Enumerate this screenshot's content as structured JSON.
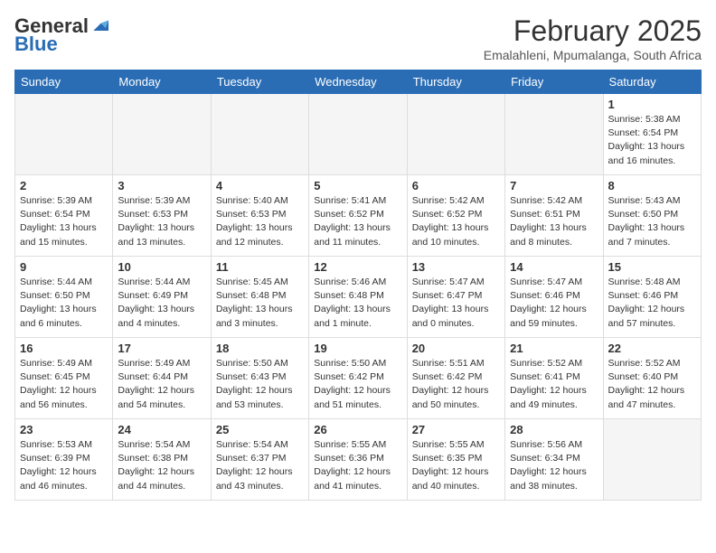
{
  "header": {
    "logo_general": "General",
    "logo_blue": "Blue",
    "month_title": "February 2025",
    "subtitle": "Emalahleni, Mpumalanga, South Africa"
  },
  "weekdays": [
    "Sunday",
    "Monday",
    "Tuesday",
    "Wednesday",
    "Thursday",
    "Friday",
    "Saturday"
  ],
  "weeks": [
    [
      {
        "day": "",
        "empty": true
      },
      {
        "day": "",
        "empty": true
      },
      {
        "day": "",
        "empty": true
      },
      {
        "day": "",
        "empty": true
      },
      {
        "day": "",
        "empty": true
      },
      {
        "day": "",
        "empty": true
      },
      {
        "day": "1",
        "sunrise": "5:38 AM",
        "sunset": "6:54 PM",
        "daylight": "13 hours and 16 minutes."
      }
    ],
    [
      {
        "day": "2",
        "sunrise": "5:39 AM",
        "sunset": "6:54 PM",
        "daylight": "13 hours and 15 minutes."
      },
      {
        "day": "3",
        "sunrise": "5:39 AM",
        "sunset": "6:53 PM",
        "daylight": "13 hours and 13 minutes."
      },
      {
        "day": "4",
        "sunrise": "5:40 AM",
        "sunset": "6:53 PM",
        "daylight": "13 hours and 12 minutes."
      },
      {
        "day": "5",
        "sunrise": "5:41 AM",
        "sunset": "6:52 PM",
        "daylight": "13 hours and 11 minutes."
      },
      {
        "day": "6",
        "sunrise": "5:42 AM",
        "sunset": "6:52 PM",
        "daylight": "13 hours and 10 minutes."
      },
      {
        "day": "7",
        "sunrise": "5:42 AM",
        "sunset": "6:51 PM",
        "daylight": "13 hours and 8 minutes."
      },
      {
        "day": "8",
        "sunrise": "5:43 AM",
        "sunset": "6:50 PM",
        "daylight": "13 hours and 7 minutes."
      }
    ],
    [
      {
        "day": "9",
        "sunrise": "5:44 AM",
        "sunset": "6:50 PM",
        "daylight": "13 hours and 6 minutes."
      },
      {
        "day": "10",
        "sunrise": "5:44 AM",
        "sunset": "6:49 PM",
        "daylight": "13 hours and 4 minutes."
      },
      {
        "day": "11",
        "sunrise": "5:45 AM",
        "sunset": "6:48 PM",
        "daylight": "13 hours and 3 minutes."
      },
      {
        "day": "12",
        "sunrise": "5:46 AM",
        "sunset": "6:48 PM",
        "daylight": "13 hours and 1 minute."
      },
      {
        "day": "13",
        "sunrise": "5:47 AM",
        "sunset": "6:47 PM",
        "daylight": "13 hours and 0 minutes."
      },
      {
        "day": "14",
        "sunrise": "5:47 AM",
        "sunset": "6:46 PM",
        "daylight": "12 hours and 59 minutes."
      },
      {
        "day": "15",
        "sunrise": "5:48 AM",
        "sunset": "6:46 PM",
        "daylight": "12 hours and 57 minutes."
      }
    ],
    [
      {
        "day": "16",
        "sunrise": "5:49 AM",
        "sunset": "6:45 PM",
        "daylight": "12 hours and 56 minutes."
      },
      {
        "day": "17",
        "sunrise": "5:49 AM",
        "sunset": "6:44 PM",
        "daylight": "12 hours and 54 minutes."
      },
      {
        "day": "18",
        "sunrise": "5:50 AM",
        "sunset": "6:43 PM",
        "daylight": "12 hours and 53 minutes."
      },
      {
        "day": "19",
        "sunrise": "5:50 AM",
        "sunset": "6:42 PM",
        "daylight": "12 hours and 51 minutes."
      },
      {
        "day": "20",
        "sunrise": "5:51 AM",
        "sunset": "6:42 PM",
        "daylight": "12 hours and 50 minutes."
      },
      {
        "day": "21",
        "sunrise": "5:52 AM",
        "sunset": "6:41 PM",
        "daylight": "12 hours and 49 minutes."
      },
      {
        "day": "22",
        "sunrise": "5:52 AM",
        "sunset": "6:40 PM",
        "daylight": "12 hours and 47 minutes."
      }
    ],
    [
      {
        "day": "23",
        "sunrise": "5:53 AM",
        "sunset": "6:39 PM",
        "daylight": "12 hours and 46 minutes."
      },
      {
        "day": "24",
        "sunrise": "5:54 AM",
        "sunset": "6:38 PM",
        "daylight": "12 hours and 44 minutes."
      },
      {
        "day": "25",
        "sunrise": "5:54 AM",
        "sunset": "6:37 PM",
        "daylight": "12 hours and 43 minutes."
      },
      {
        "day": "26",
        "sunrise": "5:55 AM",
        "sunset": "6:36 PM",
        "daylight": "12 hours and 41 minutes."
      },
      {
        "day": "27",
        "sunrise": "5:55 AM",
        "sunset": "6:35 PM",
        "daylight": "12 hours and 40 minutes."
      },
      {
        "day": "28",
        "sunrise": "5:56 AM",
        "sunset": "6:34 PM",
        "daylight": "12 hours and 38 minutes."
      },
      {
        "day": "",
        "empty": true
      }
    ]
  ]
}
